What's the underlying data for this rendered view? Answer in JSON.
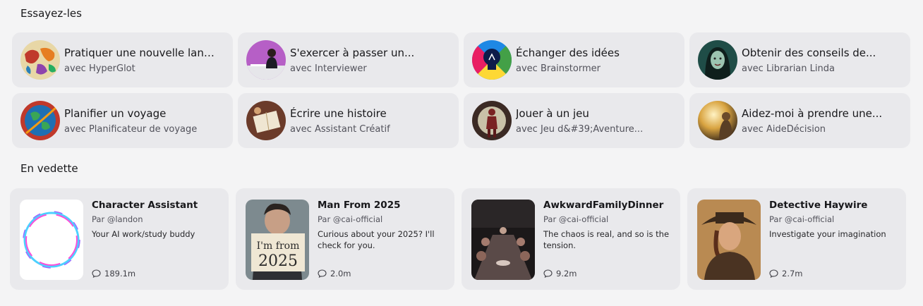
{
  "sections": {
    "try_title": "Essayez-les",
    "featured_title": "En vedette"
  },
  "try_cards": [
    {
      "title": "Pratiquer une nouvelle langue",
      "subtitle": "avec HyperGlot",
      "icon": "world-map-avatar"
    },
    {
      "title": "S'exercer à passer un...",
      "subtitle": "avec Interviewer",
      "icon": "interviewer-avatar"
    },
    {
      "title": "Échanger des idées",
      "subtitle": "avec Brainstormer",
      "icon": "lightbulb-avatar"
    },
    {
      "title": "Obtenir des conseils de...",
      "subtitle": "avec Librarian Linda",
      "icon": "librarian-avatar"
    },
    {
      "title": "Planifier un voyage",
      "subtitle": "avec Planificateur de voyage",
      "icon": "globe-avatar"
    },
    {
      "title": "Écrire une histoire",
      "subtitle": "avec Assistant Créatif",
      "icon": "notebook-avatar"
    },
    {
      "title": "Jouer à un jeu",
      "subtitle": "avec Jeu d&#39;Aventure...",
      "icon": "adventurer-avatar"
    },
    {
      "title": "Aidez-moi à prendre une...",
      "subtitle": "avec AideDécision",
      "icon": "decision-avatar"
    }
  ],
  "featured": [
    {
      "name": "Character Assistant",
      "author": "Par @landon",
      "description": "Your AI work/study buddy",
      "count": "189.1m",
      "image": "neon-ring"
    },
    {
      "name": "Man From 2025",
      "author": "Par @cai-official",
      "description": "Curious about your 2025? I'll check for you.",
      "count": "2.0m",
      "image": "man-with-sign",
      "sign_line1": "I'm from",
      "sign_line2": "2025"
    },
    {
      "name": "AwkwardFamilyDinner",
      "author": "Par @cai-official",
      "description": "The chaos is real, and so is the tension.",
      "count": "9.2m",
      "image": "dinner-table"
    },
    {
      "name": "Detective Haywire",
      "author": "Par @cai-official",
      "description": "Investigate your imagination",
      "count": "2.7m",
      "image": "detective-portrait"
    }
  ]
}
